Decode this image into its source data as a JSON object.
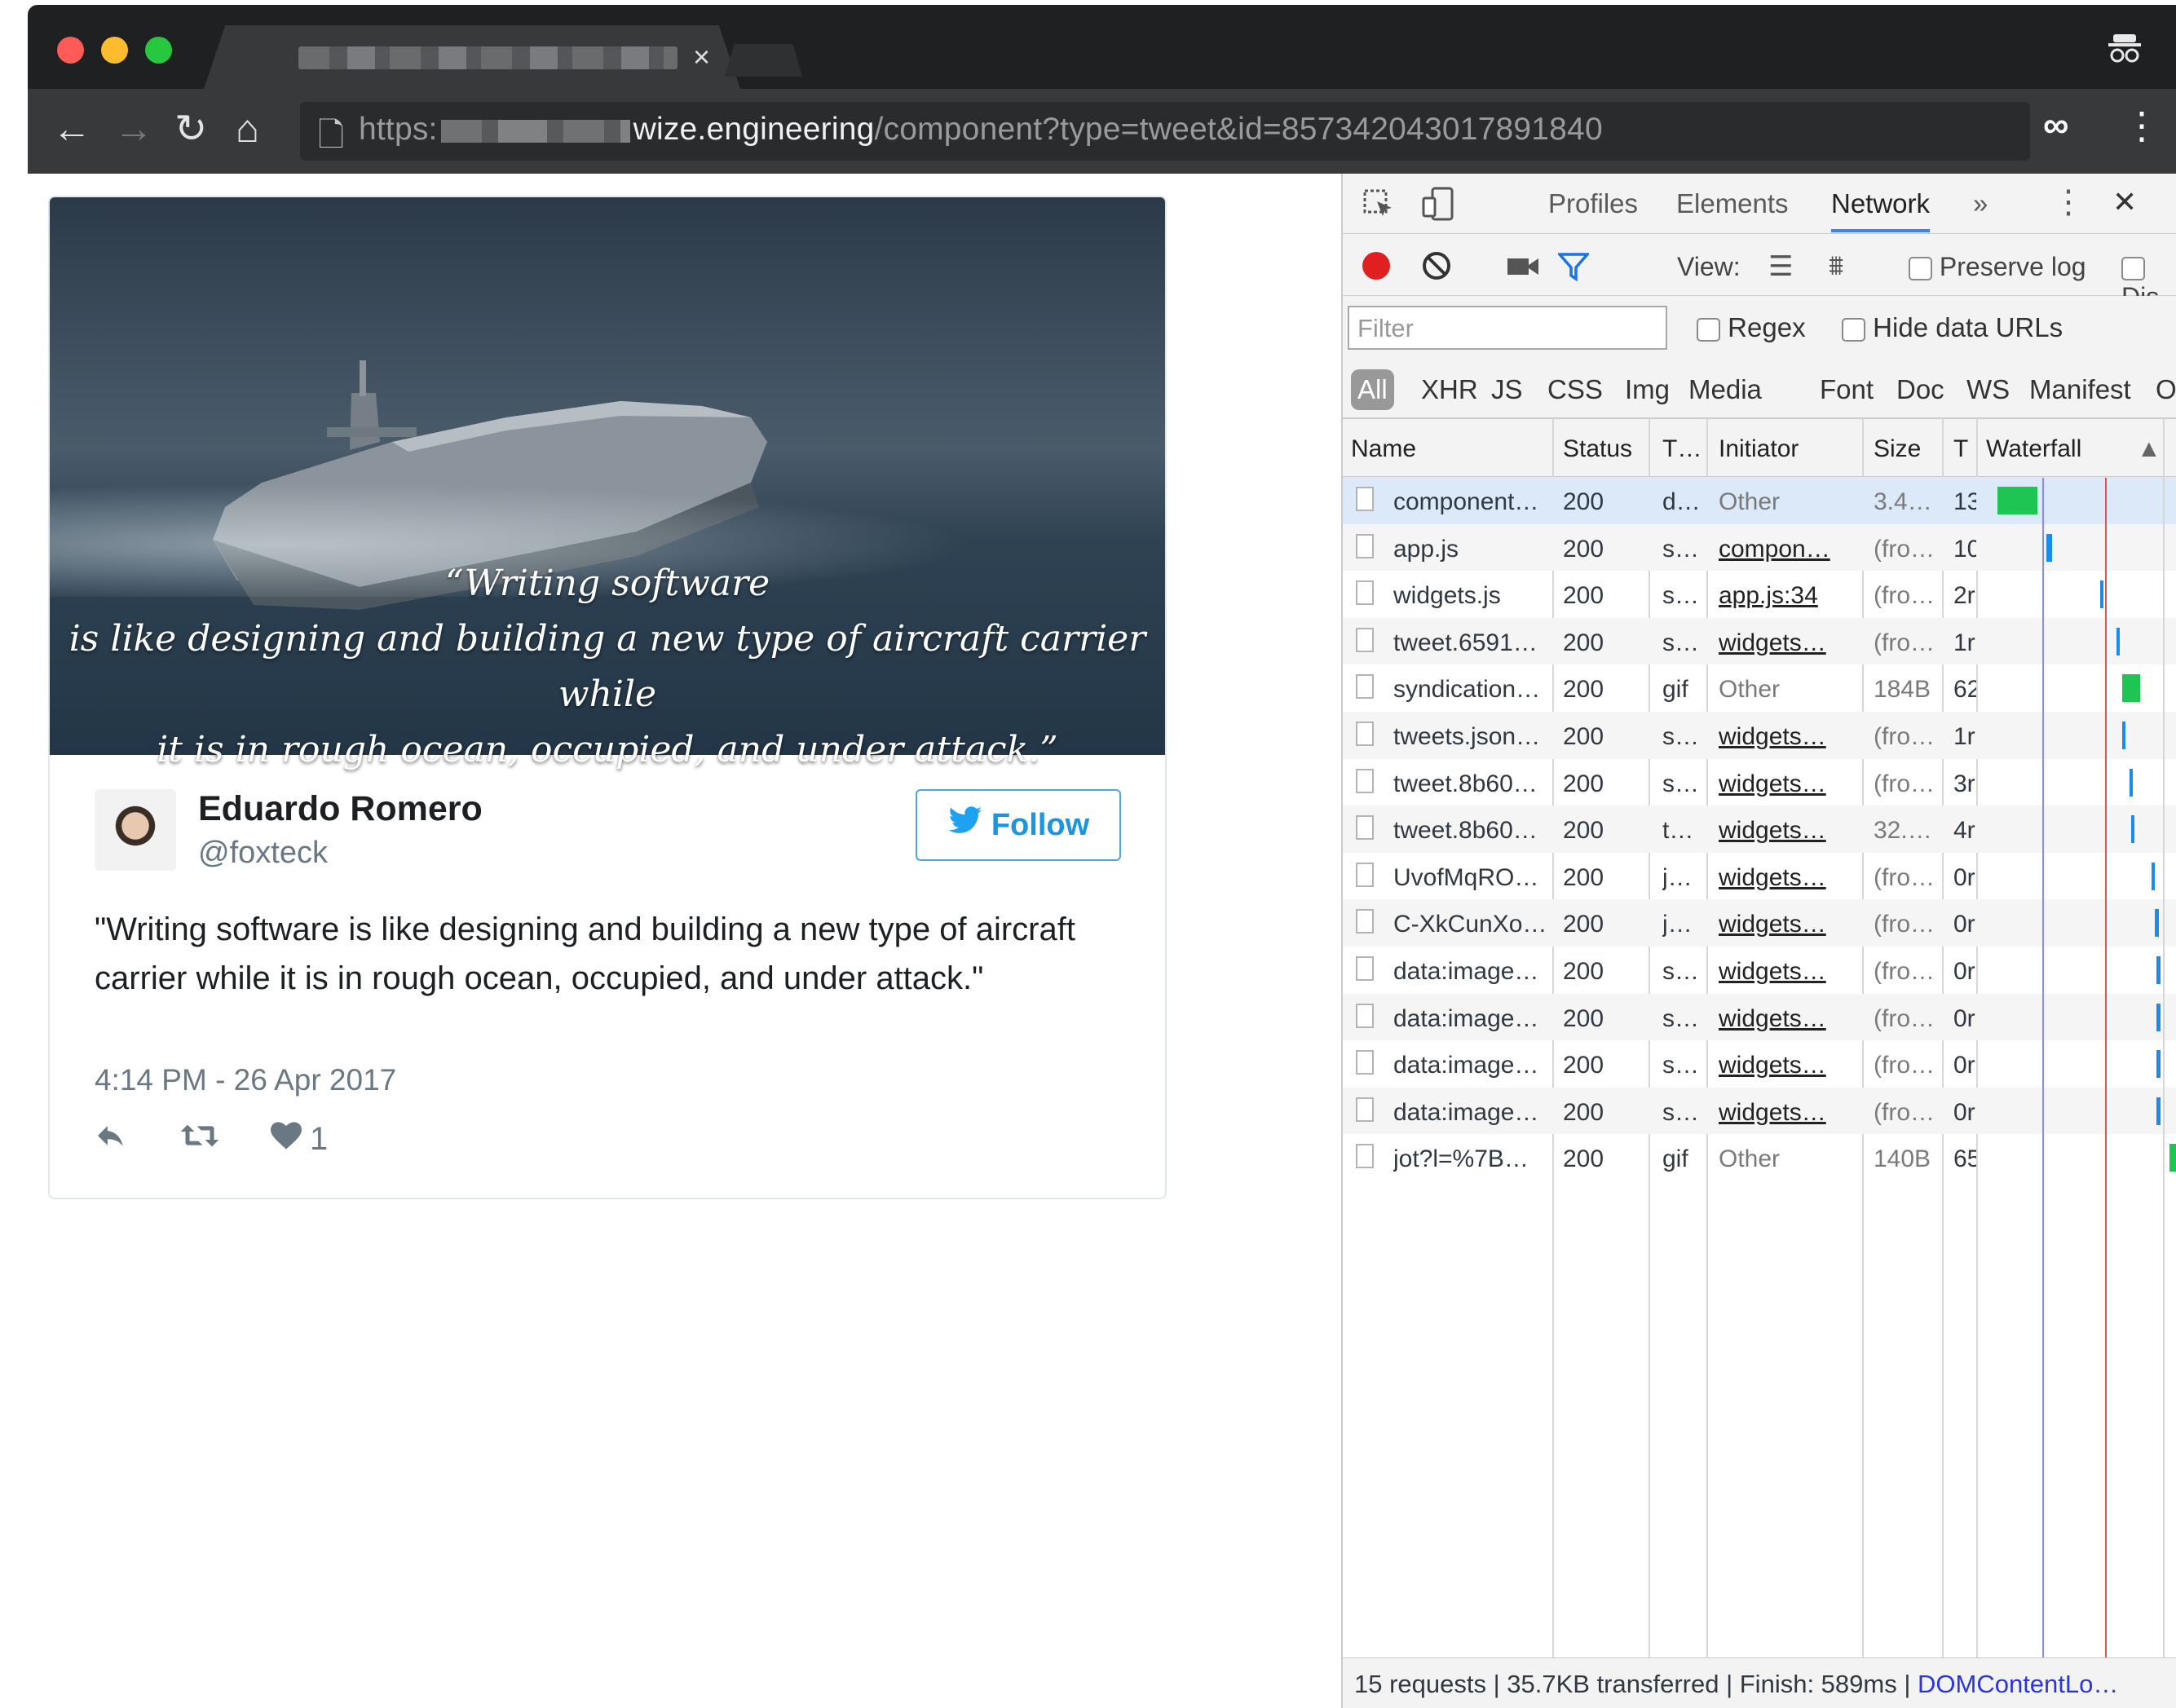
{
  "browser": {
    "tab_title": "",
    "tab_close": "×",
    "url_scheme": "https:",
    "url_host": "wize.engineering",
    "url_path": "/component?type=tweet&id=857342043017891840",
    "colors": {
      "close": "#fc5b57",
      "minimize": "#fdbc2e",
      "maximize": "#27c840"
    }
  },
  "tweet": {
    "image_quote_line1": "“Writing software",
    "image_quote_line2": "is like designing and building a new type of aircraft carrier while",
    "image_quote_line3": "it is in rough ocean, occupied, and under attack.”",
    "author_name": "Eduardo Romero",
    "author_handle": "@foxteck",
    "follow_label": "Follow",
    "text": "\"Writing software is like designing and building a new type of aircraft carrier while it is in rough ocean, occupied, and under attack.\"",
    "timestamp": "4:14 PM - 26 Apr 2017",
    "like_count": "1"
  },
  "devtools": {
    "tabs": [
      "Profiles",
      "Elements",
      "Network",
      "»"
    ],
    "active_tab": "Network",
    "close": "✕",
    "view_label": "View:",
    "preserve_log": "Preserve log",
    "disable_cache": "Dis",
    "filter_placeholder": "Filter",
    "regex": "Regex",
    "hide_data_urls": "Hide data URLs",
    "types": [
      "All",
      "XHR",
      "JS",
      "CSS",
      "Img",
      "Media",
      "Font",
      "Doc",
      "WS",
      "Manifest",
      "Othe"
    ],
    "columns": {
      "name": "Name",
      "status": "Status",
      "type": "T…",
      "initiator": "Initiator",
      "size": "Size",
      "time": "T",
      "waterfall": "Waterfall",
      "sort": "▲"
    },
    "rows": [
      {
        "name": "component…",
        "status": "200",
        "type": "d…",
        "initiator": "Other",
        "size": "3.4…",
        "time": "13",
        "wf_start": 0.02,
        "wf_len": 0.22,
        "wf_color": "#1ec552"
      },
      {
        "name": "app.js",
        "status": "200",
        "type": "s…",
        "initiator": "compon…",
        "size": "(fro…",
        "time": "10",
        "wf_start": 0.29,
        "wf_len": 0.03,
        "wf_color": "#1a8cf0"
      },
      {
        "name": "widgets.js",
        "status": "200",
        "type": "s…",
        "initiator": "app.js:34",
        "size": "(fro…",
        "time": "2r",
        "wf_start": 0.58,
        "wf_len": 0.02,
        "wf_color": "#1a8cf0"
      },
      {
        "name": "tweet.6591…",
        "status": "200",
        "type": "s…",
        "initiator": "widgets…",
        "size": "(fro…",
        "time": "1r",
        "wf_start": 0.67,
        "wf_len": 0.02,
        "wf_color": "#1a8cf0"
      },
      {
        "name": "syndication…",
        "status": "200",
        "type": "gif",
        "initiator": "Other",
        "size": "184B",
        "time": "62",
        "wf_start": 0.7,
        "wf_len": 0.1,
        "wf_color": "#1ec552"
      },
      {
        "name": "tweets.json…",
        "status": "200",
        "type": "s…",
        "initiator": "widgets…",
        "size": "(fro…",
        "time": "1r",
        "wf_start": 0.7,
        "wf_len": 0.02,
        "wf_color": "#1a8cf0"
      },
      {
        "name": "tweet.8b60…",
        "status": "200",
        "type": "s…",
        "initiator": "widgets…",
        "size": "(fro…",
        "time": "3r",
        "wf_start": 0.74,
        "wf_len": 0.02,
        "wf_color": "#1a8cf0"
      },
      {
        "name": "tweet.8b60…",
        "status": "200",
        "type": "t…",
        "initiator": "widgets…",
        "size": "32.…",
        "time": "4r",
        "wf_start": 0.75,
        "wf_len": 0.02,
        "wf_color": "#1a8cf0"
      },
      {
        "name": "UvofMqRO…",
        "status": "200",
        "type": "j…",
        "initiator": "widgets…",
        "size": "(fro…",
        "time": "0r",
        "wf_start": 0.86,
        "wf_len": 0.02,
        "wf_color": "#1a8cf0"
      },
      {
        "name": "C-XkCunXo…",
        "status": "200",
        "type": "j…",
        "initiator": "widgets…",
        "size": "(fro…",
        "time": "0r",
        "wf_start": 0.88,
        "wf_len": 0.02,
        "wf_color": "#1a8cf0"
      },
      {
        "name": "data:image…",
        "status": "200",
        "type": "s…",
        "initiator": "widgets…",
        "size": "(fro…",
        "time": "0r",
        "wf_start": 0.89,
        "wf_len": 0.02,
        "wf_color": "#1a8cf0"
      },
      {
        "name": "data:image…",
        "status": "200",
        "type": "s…",
        "initiator": "widgets…",
        "size": "(fro…",
        "time": "0r",
        "wf_start": 0.89,
        "wf_len": 0.02,
        "wf_color": "#1a8cf0"
      },
      {
        "name": "data:image…",
        "status": "200",
        "type": "s…",
        "initiator": "widgets…",
        "size": "(fro…",
        "time": "0r",
        "wf_start": 0.89,
        "wf_len": 0.02,
        "wf_color": "#1a8cf0"
      },
      {
        "name": "data:image…",
        "status": "200",
        "type": "s…",
        "initiator": "widgets…",
        "size": "(fro…",
        "time": "0r",
        "wf_start": 0.89,
        "wf_len": 0.02,
        "wf_color": "#1a8cf0"
      },
      {
        "name": "jot?l=%7B…",
        "status": "200",
        "type": "gif",
        "initiator": "Other",
        "size": "140B",
        "time": "65",
        "wf_start": 0.96,
        "wf_len": 0.12,
        "wf_color": "#1ec552"
      }
    ],
    "status_bar": "15 requests | 35.7KB transferred | Finish: 589ms | ",
    "status_bar_dom": "DOMContentLo…"
  }
}
